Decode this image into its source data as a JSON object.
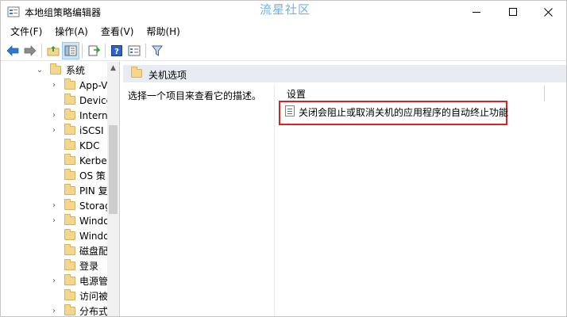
{
  "window": {
    "title": "本地组策略编辑器",
    "watermark": "流星社区",
    "controls": {
      "minimize": "minimize",
      "maximize": "maximize",
      "close": "✕"
    }
  },
  "menu": {
    "items": [
      {
        "label": "文件(F)"
      },
      {
        "label": "操作(A)"
      },
      {
        "label": "查看(V)"
      },
      {
        "label": "帮助(H)"
      }
    ]
  },
  "toolbar": {
    "icons": [
      "back-arrow-icon",
      "forward-arrow-icon",
      "up-folder-icon",
      "show-hide-tree-icon",
      "export-list-icon",
      "help-icon",
      "properties-icon",
      "filter-icon"
    ]
  },
  "tree": {
    "items": [
      {
        "label": "系统",
        "expander": "⌄"
      },
      {
        "label": "App-V",
        "expander": "›"
      },
      {
        "label": "Device",
        "expander": ""
      },
      {
        "label": "Intern",
        "expander": "›"
      },
      {
        "label": "iSCSI",
        "expander": "›"
      },
      {
        "label": "KDC",
        "expander": ""
      },
      {
        "label": "Kerbe",
        "expander": ""
      },
      {
        "label": "OS 策",
        "expander": ""
      },
      {
        "label": "PIN 复",
        "expander": ""
      },
      {
        "label": "Storag",
        "expander": "›"
      },
      {
        "label": "Windo",
        "expander": "›"
      },
      {
        "label": "Windo",
        "expander": ""
      },
      {
        "label": "磁盘配",
        "expander": ""
      },
      {
        "label": "登录",
        "expander": ""
      },
      {
        "label": "电源管",
        "expander": "›"
      },
      {
        "label": "访问被",
        "expander": ""
      },
      {
        "label": "分布式",
        "expander": "›"
      }
    ],
    "scroll_up": "▲"
  },
  "details": {
    "folder_title": "关机选项",
    "description": "选择一个项目来查看它的描述。",
    "column_header": "设置",
    "policy": "关闭会阻止或取消关机的应用程序的自动终止功能"
  },
  "colors": {
    "highlight_border": "#e02020",
    "header_band": "#e8ecf2",
    "watermark": "#73b0ea",
    "folder": "#f4d78c"
  }
}
